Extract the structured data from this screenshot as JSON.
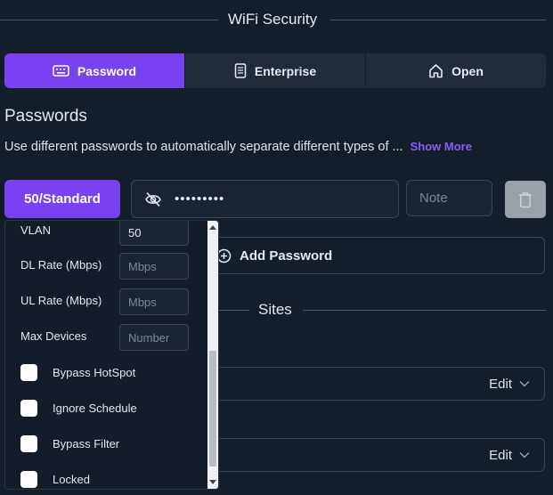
{
  "section": {
    "title": "WiFi Security"
  },
  "tabs": [
    {
      "label": "Password",
      "icon": "keyboard-icon",
      "active": true
    },
    {
      "label": "Enterprise",
      "icon": "document-icon",
      "active": false
    },
    {
      "label": "Open",
      "icon": "home-icon",
      "active": false
    }
  ],
  "passwords": {
    "heading": "Passwords",
    "description": "Use different passwords to automatically separate different types of ...",
    "show_more": "Show More",
    "vlan_button": "50/Standard",
    "password_value": "•••••••••",
    "note_placeholder": "Note",
    "add_password": "Add Password"
  },
  "sites": {
    "title": "Sites",
    "edit_label": "Edit"
  },
  "dropdown": {
    "vlan_label": "VLAN",
    "vlan_value": "50",
    "dl_label": "DL Rate (Mbps)",
    "dl_placeholder": "Mbps",
    "ul_label": "UL Rate (Mbps)",
    "ul_placeholder": "Mbps",
    "max_label": "Max Devices",
    "max_placeholder": "Number",
    "checkboxes": [
      "Bypass HotSpot",
      "Ignore Schedule",
      "Bypass Filter",
      "Locked"
    ]
  },
  "colors": {
    "accent": "#7a41f0",
    "background": "#141d2a",
    "link": "#8b5cf6"
  }
}
